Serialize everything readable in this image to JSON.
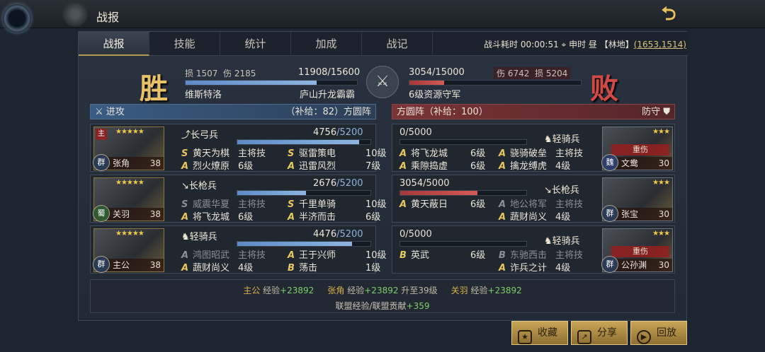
{
  "window": {
    "title": "战报"
  },
  "tabs": [
    "战报",
    "技能",
    "统计",
    "加成",
    "战记"
  ],
  "battle_info": {
    "prefix": "战斗耗时 00:00:51  ⌖ 申时 昼 【林地】",
    "coord": "(1653,1514)"
  },
  "attacker": {
    "result": "胜",
    "loss_label": "损",
    "loss": "1507",
    "hurt_label": "伤",
    "hurt": "2185",
    "troops": "11908/15600",
    "troop_fraction": 0.763,
    "name": "维斯特洛",
    "team": "庐山升龙霸霸",
    "side_label": "进攻",
    "side_info": "（补给：82）方圆阵"
  },
  "defender": {
    "result": "败",
    "loss_label": "损",
    "loss": "5204",
    "hurt_label": "伤",
    "hurt": "6742",
    "troops": "3054/15000",
    "troop_fraction": 0.204,
    "name": "6级资源守军",
    "side_label": "防守",
    "side_info": "方圆阵（补给：100）"
  },
  "att_generals": [
    {
      "name": "张角",
      "level": "38",
      "faction": "群",
      "main": "主",
      "troop_type": "长弓兵",
      "hp": "4756",
      "hp_max": "/5200",
      "hp_fraction": 0.915,
      "skills": [
        {
          "t": "S",
          "name": "黄天为棋",
          "lv": "主将技"
        },
        {
          "t": "S",
          "name": "驱雷策电",
          "lv": "10级"
        },
        {
          "t": "A",
          "name": "烈火燎原",
          "lv": "6级"
        },
        {
          "t": "A",
          "name": "迅雷风烈",
          "lv": "7级"
        }
      ]
    },
    {
      "name": "关羽",
      "level": "38",
      "faction": "蜀",
      "troop_type": "长枪兵",
      "hp": "2676",
      "hp_max": "/5200",
      "hp_fraction": 0.515,
      "skills": [
        {
          "t": "S",
          "name": "威震华夏",
          "lv": "主将技",
          "dim": true
        },
        {
          "t": "S",
          "name": "千里单骑",
          "lv": "10级"
        },
        {
          "t": "A",
          "name": "将飞龙城",
          "lv": "6级"
        },
        {
          "t": "A",
          "name": "半济而击",
          "lv": "6级"
        }
      ]
    },
    {
      "name": "主公",
      "level": "38",
      "faction": "群",
      "troop_type": "轻骑兵",
      "hp": "4476",
      "hp_max": "/5200",
      "hp_fraction": 0.861,
      "skills": [
        {
          "t": "A",
          "name": "鸿图昭武",
          "lv": "主将技",
          "dim": true
        },
        {
          "t": "A",
          "name": "王于兴师",
          "lv": "10级"
        },
        {
          "t": "A",
          "name": "蔬财尚义",
          "lv": "4级"
        },
        {
          "t": "B",
          "name": "荡击",
          "lv": "1级"
        }
      ]
    }
  ],
  "def_generals": [
    {
      "name": "文鸯",
      "level": "30",
      "faction": "魏",
      "status": "重伤",
      "troop_type": "轻骑兵",
      "hp": "0",
      "hp_max": "/5000",
      "hp_fraction": 0,
      "skills": [
        {
          "t": "A",
          "name": "将飞龙城",
          "lv": "6级"
        },
        {
          "t": "A",
          "name": "骁骑破垒",
          "lv": "主将技"
        },
        {
          "t": "A",
          "name": "乘隙捣虚",
          "lv": "6级"
        },
        {
          "t": "A",
          "name": "擒龙缚虎",
          "lv": "4级"
        }
      ]
    },
    {
      "name": "张宝",
      "level": "30",
      "faction": "群",
      "troop_type": "长枪兵",
      "hp": "3054",
      "hp_max": "/5000",
      "hp_fraction": 0.611,
      "skills": [
        {
          "t": "A",
          "name": "黄天蔽日",
          "lv": "6级"
        },
        {
          "t": "A",
          "name": "地公将军",
          "lv": "主将技",
          "dim": true
        },
        {
          "t": "",
          "name": "",
          "lv": ""
        },
        {
          "t": "A",
          "name": "蔬财尚义",
          "lv": "4级"
        }
      ]
    },
    {
      "name": "公孙渊",
      "level": "30",
      "faction": "群",
      "status": "重伤",
      "troop_type": "轻骑兵",
      "hp": "0",
      "hp_max": "/5000",
      "hp_fraction": 0,
      "skills": [
        {
          "t": "B",
          "name": "英武",
          "lv": "6级"
        },
        {
          "t": "B",
          "name": "东驰西击",
          "lv": "主将技",
          "dim": true
        },
        {
          "t": "",
          "name": "",
          "lv": ""
        },
        {
          "t": "A",
          "name": "诈兵之计",
          "lv": "4级"
        }
      ]
    }
  ],
  "footer": {
    "p1": "主公",
    "e1": "经验",
    "v1": "+23892",
    "p2": "张角",
    "e2": "经验",
    "v2": "+23892",
    "x2": "升至39级",
    "p3": "关羽",
    "e3": "经验",
    "v3": "+23892",
    "alliance": "联盟经验/联盟贡献",
    "alliance_val": "+359"
  },
  "buttons": {
    "collect": "收藏",
    "share": "分享",
    "replay": "回放"
  }
}
